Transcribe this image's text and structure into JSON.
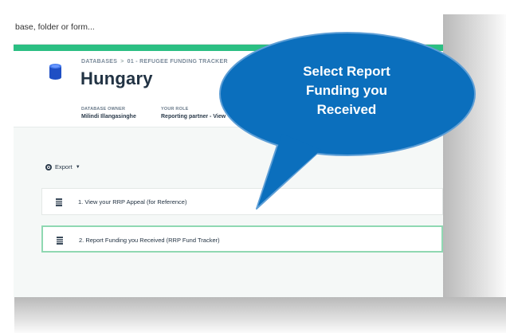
{
  "search": {
    "placeholder_text": "base, folder or form..."
  },
  "breadcrumb": {
    "root": "DATABASES",
    "separator": ">",
    "current": "01 - REFUGEE FUNDING TRACKER"
  },
  "header": {
    "title": "Hungary",
    "owner_label": "DATABASE OWNER",
    "owner_value": "Milindi Illangasinghe",
    "role_label": "YOUR ROLE",
    "role_value": "Reporting partner - View"
  },
  "toolbar": {
    "export_label": "Export",
    "export_caret": "▼"
  },
  "forms": [
    {
      "label": "1. View your RRP Appeal (for Reference)",
      "icon": "form-icon"
    },
    {
      "label": "2. Report Funding you Received (RRP Fund Tracker)",
      "icon": "form-icon"
    }
  ],
  "callout": {
    "line1": "Select Report",
    "line2": "Funding you",
    "line3": "Received",
    "fill_color": "#0b6fbd",
    "border_color": "#5f9fd6"
  },
  "colors": {
    "accent_green": "#2bbf83",
    "selected_border": "#8fd8b2",
    "title_text": "#223344"
  }
}
